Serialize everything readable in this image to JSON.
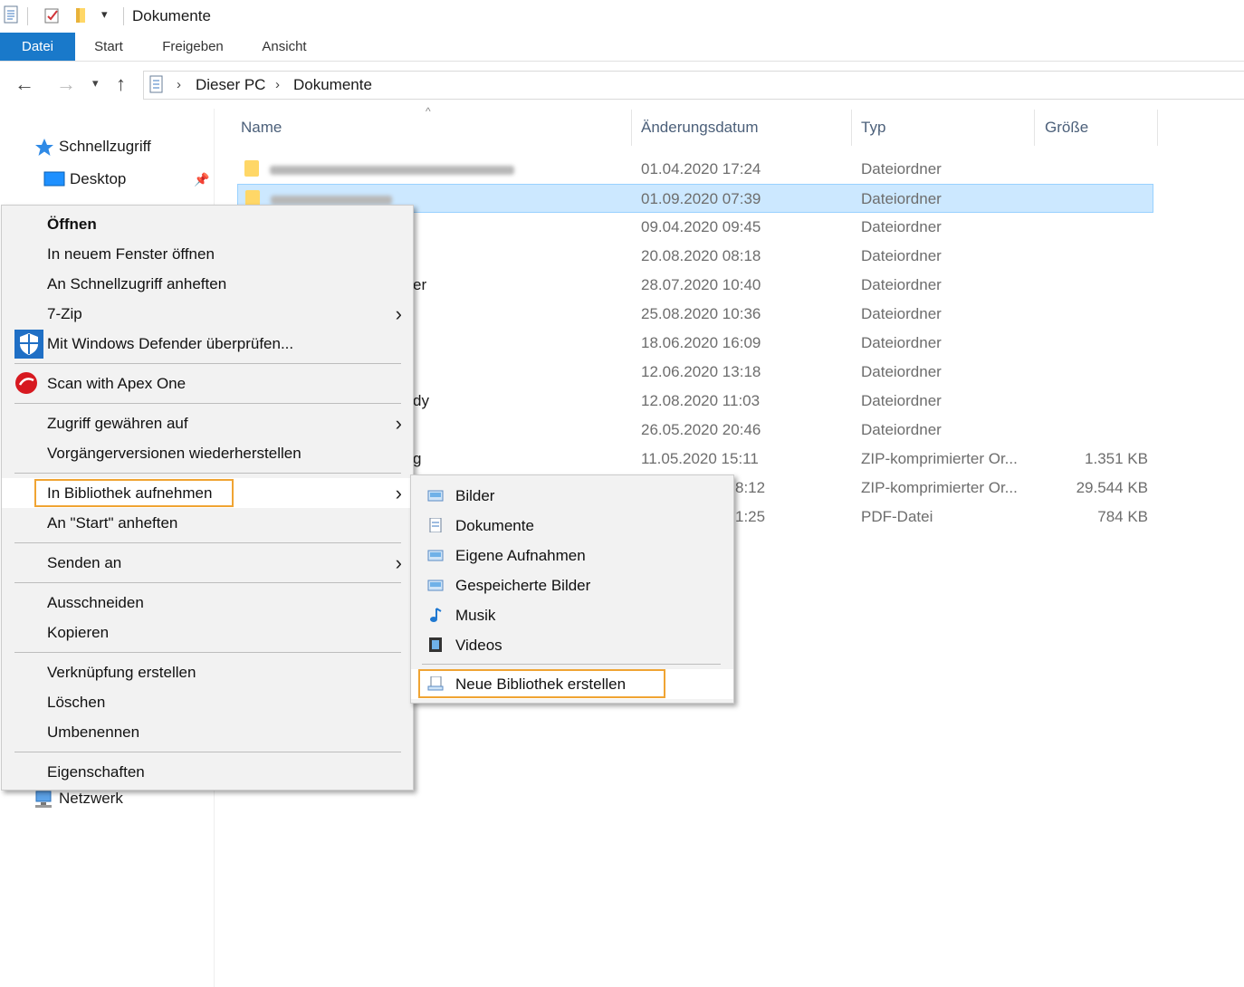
{
  "window": {
    "title": "Dokumente"
  },
  "ribbon": {
    "tabs": [
      "Datei",
      "Start",
      "Freigeben",
      "Ansicht"
    ]
  },
  "breadcrumb": [
    "Dieser PC",
    "Dokumente"
  ],
  "navpane": {
    "quick_access": "Schnellzugriff",
    "desktop": "Desktop",
    "network": "Netzwerk"
  },
  "columns": {
    "name": "Name",
    "date": "Änderungsdatum",
    "type": "Typ",
    "size": "Größe"
  },
  "rows": [
    {
      "date": "01.04.2020 17:24",
      "type": "Dateiordner",
      "size": "",
      "name_tail": ""
    },
    {
      "date": "01.09.2020 07:39",
      "type": "Dateiordner",
      "size": "",
      "name_tail": ""
    },
    {
      "date": "09.04.2020 09:45",
      "type": "Dateiordner",
      "size": "",
      "name_tail": ""
    },
    {
      "date": "20.08.2020 08:18",
      "type": "Dateiordner",
      "size": "",
      "name_tail": ""
    },
    {
      "date": "28.07.2020 10:40",
      "type": "Dateiordner",
      "size": "",
      "name_tail": "er"
    },
    {
      "date": "25.08.2020 10:36",
      "type": "Dateiordner",
      "size": "",
      "name_tail": ""
    },
    {
      "date": "18.06.2020 16:09",
      "type": "Dateiordner",
      "size": "",
      "name_tail": ""
    },
    {
      "date": "12.06.2020 13:18",
      "type": "Dateiordner",
      "size": "",
      "name_tail": ""
    },
    {
      "date": "12.08.2020 11:03",
      "type": "Dateiordner",
      "size": "",
      "name_tail": "dy"
    },
    {
      "date": "26.05.2020 20:46",
      "type": "Dateiordner",
      "size": "",
      "name_tail": ""
    },
    {
      "date": "11.05.2020 15:11",
      "type": "ZIP-komprimierter Or...",
      "size": "1.351 KB",
      "name_tail": "g"
    },
    {
      "date": "8:12",
      "type": "ZIP-komprimierter Or...",
      "size": "29.544 KB",
      "name_tail": ""
    },
    {
      "date": "1:25",
      "type": "PDF-Datei",
      "size": "784 KB",
      "name_tail": ""
    }
  ],
  "context_menu": {
    "open": "Öffnen",
    "open_new_window": "In neuem Fenster öffnen",
    "pin_quick": "An Schnellzugriff anheften",
    "zip": "7-Zip",
    "defender": "Mit Windows Defender überprüfen...",
    "apex": "Scan with Apex One",
    "grant_access": "Zugriff gewähren auf",
    "restore_prev": "Vorgängerversionen wiederherstellen",
    "include_library": "In Bibliothek aufnehmen",
    "pin_start": "An \"Start\" anheften",
    "send_to": "Senden an",
    "cut": "Ausschneiden",
    "copy": "Kopieren",
    "shortcut": "Verknüpfung erstellen",
    "delete": "Löschen",
    "rename": "Umbenennen",
    "properties": "Eigenschaften"
  },
  "submenu": {
    "items": [
      "Bilder",
      "Dokumente",
      "Eigene Aufnahmen",
      "Gespeicherte Bilder",
      "Musik",
      "Videos"
    ],
    "new_library": "Neue Bibliothek erstellen"
  },
  "colors": {
    "accent": "#1979ca",
    "selection": "#cce8ff",
    "highlight": "#f0a433"
  }
}
